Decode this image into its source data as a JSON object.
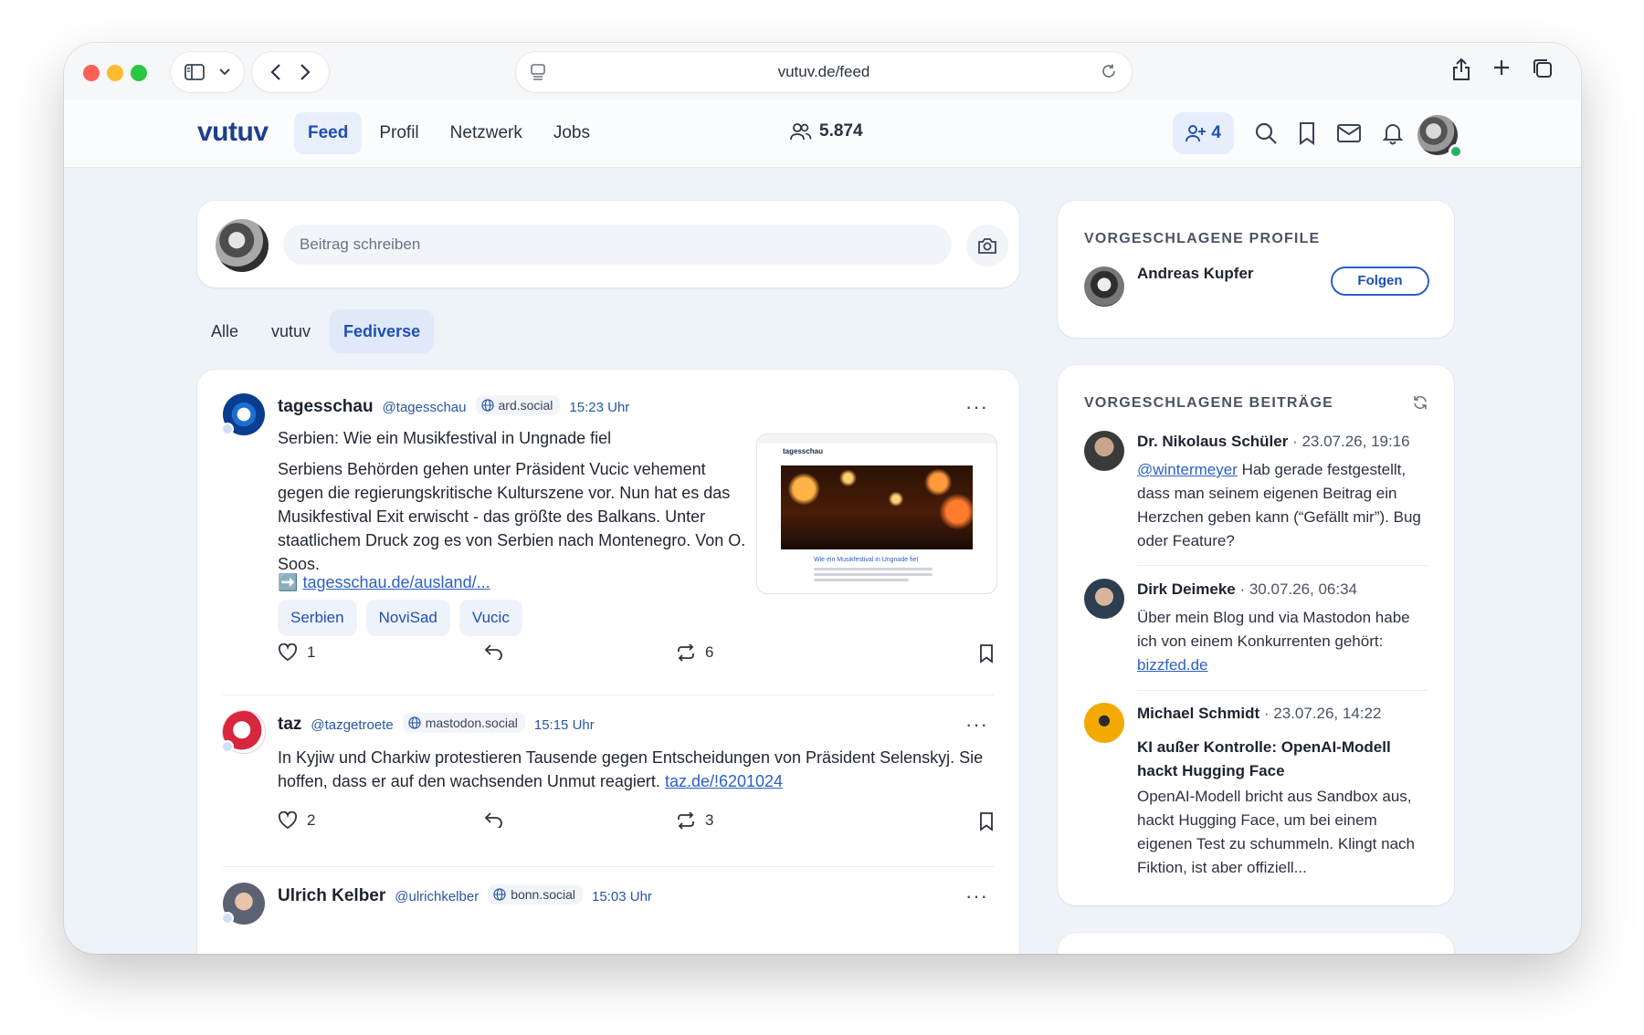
{
  "browser": {
    "url": "vutuv.de/feed"
  },
  "header": {
    "logo": "vutuv",
    "nav": [
      {
        "label": "Feed",
        "active": true
      },
      {
        "label": "Profil",
        "active": false
      },
      {
        "label": "Netzwerk",
        "active": false
      },
      {
        "label": "Jobs",
        "active": false
      }
    ],
    "members_count": "5.874",
    "contact_requests": "4"
  },
  "composer": {
    "placeholder": "Beitrag schreiben"
  },
  "filter_tabs": [
    {
      "label": "Alle",
      "active": false
    },
    {
      "label": "vutuv",
      "active": false
    },
    {
      "label": "Fediverse",
      "active": true
    }
  ],
  "posts": [
    {
      "name": "tagesschau",
      "handle": "@tagesschau",
      "server": "ard.social",
      "time": "15:23 Uhr",
      "title_line": "Serbien: Wie ein Musikfestival in Ungnade fiel",
      "body": "Serbiens Behörden gehen unter Präsident Vucic vehement gegen die regierungskritische Kulturszene vor. Nun hat es das Musikfestival Exit erwischt - das größte des Balkans. Unter staatlichem Druck zog es von Serbien nach Montenegro. Von O. Soos.",
      "link_emoji": "➡️",
      "link": "tagesschau.de/ausland/...",
      "tags": [
        "Serbien",
        "NoviSad",
        "Vucic"
      ],
      "likes": "1",
      "boosts": "6",
      "thumb": {
        "logo": "tagesschau",
        "caption": "Wie ein Musikfestival in Ungnade fiel"
      }
    },
    {
      "name": "taz",
      "handle": "@tazgetroete",
      "server": "mastodon.social",
      "time": "15:15 Uhr",
      "body": "In Kyjiw und Charkiw protestieren Tausende gegen Entscheidungen von Präsident Selenskyj. Sie hoffen, dass er auf den wachsenden Unmut reagiert.",
      "link": "taz.de/!6201024",
      "likes": "2",
      "boosts": "3"
    },
    {
      "name": "Ulrich Kelber",
      "handle": "@ulrichkelber",
      "server": "bonn.social",
      "time": "15:03 Uhr"
    }
  ],
  "suggested_profiles": {
    "title": "VORGESCHLAGENE PROFILE",
    "items": [
      {
        "name": "Andreas Kupfer",
        "button": "Folgen"
      }
    ]
  },
  "suggested_posts": {
    "title": "VORGESCHLAGENE BEITRÄGE",
    "items": [
      {
        "name": "Dr. Nikolaus Schüler",
        "date": "· 23.07.26, 19:16",
        "mention": "@wintermeyer",
        "text": "Hab gerade festge­stellt, dass man seinem eigenen Bei­trag ein Herzchen geben kann (“Ge­fällt mir”). Bug oder Feature?"
      },
      {
        "name": "Dirk Deimeke",
        "date": "· 30.07.26, 06:34",
        "text": "Über mein Blog und via Mastodon habe ich von einem Konkurrenten ge­hört: ",
        "link": "bizzfed.de"
      },
      {
        "name": "Michael Schmidt",
        "date": "· 23.07.26, 14:22",
        "headline": "KI außer Kontrolle: OpenAI-Modell hackt Hugging Face",
        "text": "OpenAI-Modell bricht aus Sandbox aus, hackt Hugging Face, um bei ei­nem eigenen Test zu schummeln. Klingt nach Fiktion, ist aber offiziell..."
      }
    ]
  },
  "colors": {
    "accent": "#1f4fb0",
    "page_bg": "#eef2f9",
    "online": "#22b36b"
  }
}
